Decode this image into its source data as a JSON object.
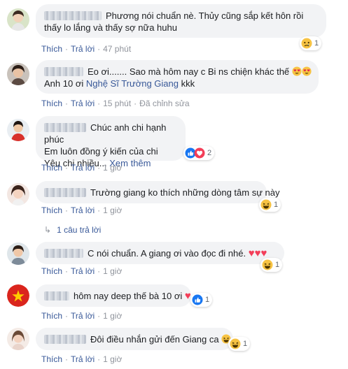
{
  "comments": [
    {
      "text_line1": "Phương nói chuẩn nè. Thủy cũng sắp kết hôn rồi",
      "text_line2": "thấy lo lắng và thấy sợ nữa huhu",
      "reaction_count": "1",
      "reaction_icon": "sad-icon",
      "like": "Thích",
      "reply": "Trả lời",
      "time": "47 phút"
    },
    {
      "text_line1": "Eo ơi....... Sao mà hôm nay c Bi ns chiện khác thế",
      "text_line2_prefix": "Anh 10 ơi",
      "mention": "Nghệ Sĩ Trường Giang",
      "text_line2_suffix": "kkk",
      "like": "Thích",
      "reply": "Trả lời",
      "time": "15 phút",
      "edited": "Đã chỉnh sửa"
    },
    {
      "text_line1": "Chúc anh chi hạnh phúc",
      "text_line2": "Em luôn đồng ý kiến của chi",
      "text_line3": "Yêu chi nhiều...",
      "see_more": "Xem thêm",
      "reaction_count": "2",
      "like": "Thích",
      "reply": "Trả lời",
      "time": "1 giờ"
    },
    {
      "text_line1": "Trường giang ko thích những dòng tâm sự này",
      "reaction_count": "1",
      "like": "Thích",
      "reply": "Trả lời",
      "time": "1 giờ",
      "replies_link": "1 câu trả lời"
    },
    {
      "text_line1": "C nói chuẩn. A giang ơi vào đọc đi nhé.",
      "reaction_count": "1",
      "like": "Thích",
      "reply": "Trả lời",
      "time": "1 giờ"
    },
    {
      "text_line1": "hôm nay deep thế bà 10 ơi",
      "reaction_count": "1",
      "like": "Thích",
      "reply": "Trả lời",
      "time": "1 giờ"
    },
    {
      "text_line1": "Đôi điều nhắn gửi đến Giang ca",
      "reaction_count": "1",
      "like": "Thích",
      "reply": "Trả lời",
      "time": "1 giờ"
    }
  ],
  "colors": {
    "link": "#385898",
    "meta": "#90949c",
    "bubble": "#f2f3f5",
    "heart": "#f33e58",
    "like_blue": "#1877f2"
  }
}
